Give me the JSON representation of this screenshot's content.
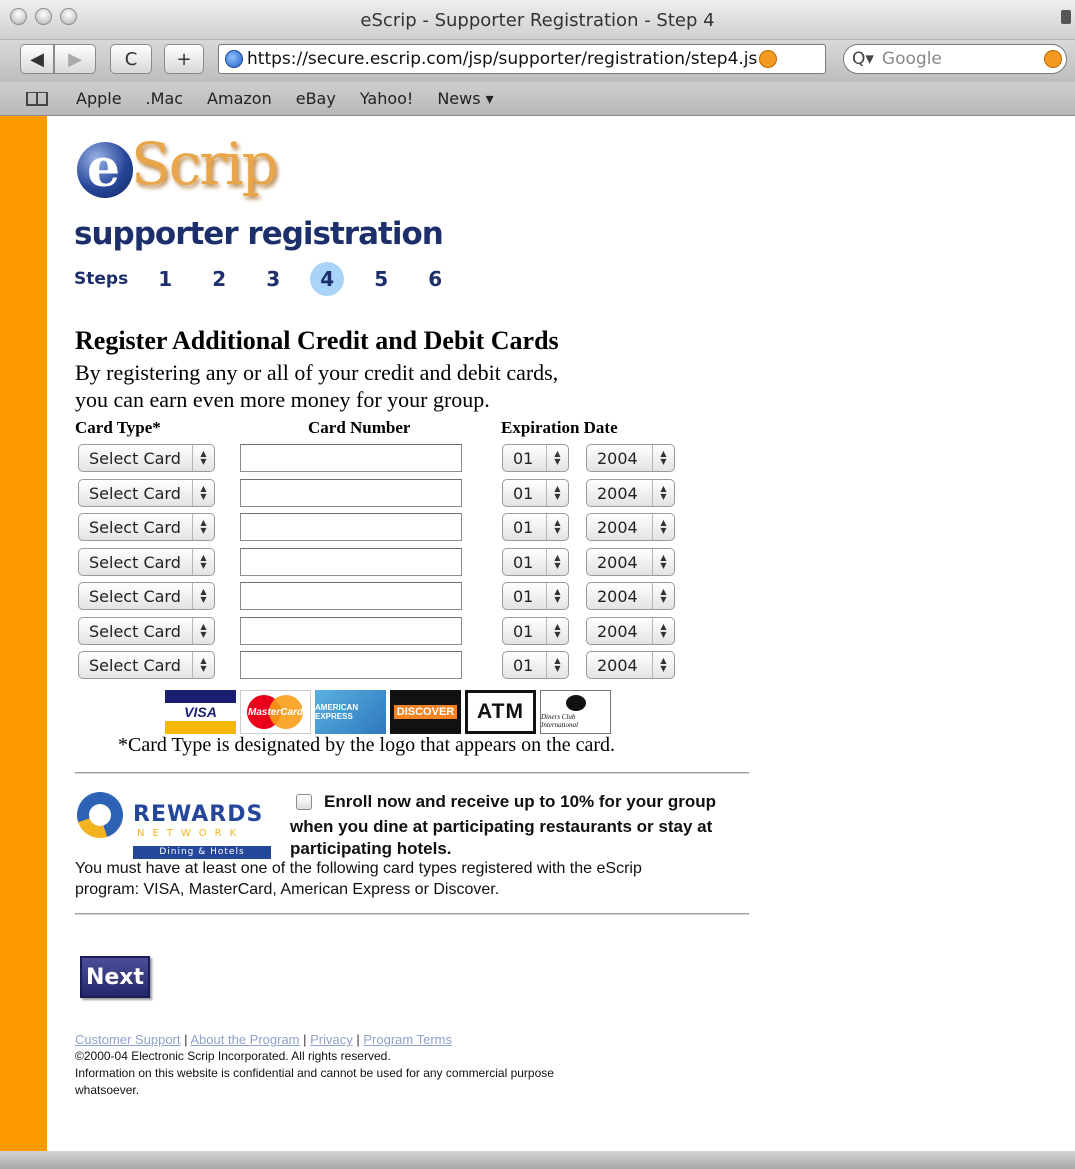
{
  "window": {
    "title": "eScrip - Supporter Registration - Step 4"
  },
  "toolbar": {
    "back_label": "◀",
    "forward_label": "▶",
    "reload_label": "C",
    "add_label": "+",
    "url": "https://secure.escrip.com/jsp/supporter/registration/step4.js",
    "search_placeholder": "Google",
    "search_icon": "Q▾"
  },
  "bookmarks": [
    "Apple",
    ".Mac",
    "Amazon",
    "eBay",
    "Yahoo!",
    "News ▾"
  ],
  "colors": {
    "sidebar": "#fe9a00",
    "heading_blue": "#1d2f6b",
    "active_step": "#a9d4f7"
  },
  "logo": {
    "e": "e",
    "text": "Scrip"
  },
  "page": {
    "title": "supporter registration",
    "steps_label": "Steps",
    "steps": [
      "1",
      "2",
      "3",
      "4",
      "5",
      "6"
    ],
    "active_step": "4"
  },
  "section": {
    "title": "Register Additional Credit and Debit Cards",
    "intro_line1": "By registering any or all of your credit and debit cards,",
    "intro_line2": "you can earn even more money for your group."
  },
  "table": {
    "col_card_type": "Card Type*",
    "col_card_number": "Card Number",
    "col_expiration": "Expiration Date",
    "rows": [
      {
        "card": "Select Card",
        "number": "",
        "month": "01",
        "year": "2004"
      },
      {
        "card": "Select Card",
        "number": "",
        "month": "01",
        "year": "2004"
      },
      {
        "card": "Select Card",
        "number": "",
        "month": "01",
        "year": "2004"
      },
      {
        "card": "Select Card",
        "number": "",
        "month": "01",
        "year": "2004"
      },
      {
        "card": "Select Card",
        "number": "",
        "month": "01",
        "year": "2004"
      },
      {
        "card": "Select Card",
        "number": "",
        "month": "01",
        "year": "2004"
      },
      {
        "card": "Select Card",
        "number": "",
        "month": "01",
        "year": "2004"
      }
    ]
  },
  "card_logos": {
    "visa": "VISA",
    "mastercard": "MasterCard",
    "amex": "AMERICAN EXPRESS",
    "discover": "DISCOVER",
    "atm": "ATM",
    "diners": "Diners Club International"
  },
  "card_note": "*Card Type is designated by the logo that appears on the card.",
  "rewards": {
    "logo_word": "REWARDS",
    "logo_network": "NETWORK",
    "logo_dining": "Dining & Hotels",
    "enroll_line1": "Enroll now and receive up to 10% for your group",
    "enroll_line2": "when you dine at participating restaurants or stay at",
    "enroll_line3": "participating hotels.",
    "must_line1": "You must have at least one of the following card types registered with the eScrip",
    "must_line2": "program: VISA, MasterCard, American Express or Discover."
  },
  "next_label": "Next",
  "footer": {
    "links": [
      "Customer Support",
      "About the Program",
      "Privacy",
      "Program Terms"
    ],
    "separator": " | ",
    "copyright": "©2000-04 Electronic Scrip Incorporated. All rights reserved.",
    "info_line1": "Information on this website is confidential and cannot be used for any commercial purpose",
    "info_line2": "whatsoever."
  }
}
